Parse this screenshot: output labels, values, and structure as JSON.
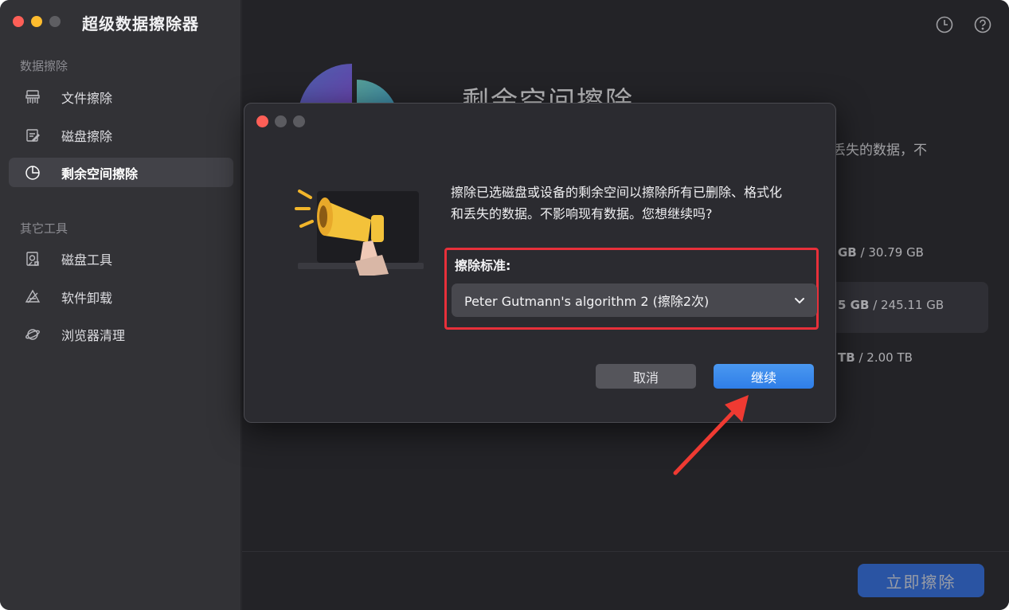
{
  "app": {
    "title": "超级数据擦除器"
  },
  "sidebar": {
    "section1": "数据擦除",
    "section2": "其它工具",
    "items": [
      {
        "label": "文件擦除",
        "icon": "shredder-icon"
      },
      {
        "label": "磁盘擦除",
        "icon": "disk-erase-icon"
      },
      {
        "label": "剩余空间擦除",
        "icon": "pie-chart-icon",
        "active": true
      },
      {
        "label": "磁盘工具",
        "icon": "disk-tools-icon"
      },
      {
        "label": "软件卸载",
        "icon": "uninstall-icon"
      },
      {
        "label": "浏览器清理",
        "icon": "browser-icon"
      }
    ]
  },
  "header": {
    "history_icon": "clock-icon",
    "help_icon": "help-icon"
  },
  "main": {
    "title": "剩余空间擦除",
    "desc_fragment": "司丢失的数据，不",
    "drives": [
      {
        "value": "GB",
        "total": "/ 30.79 GB"
      },
      {
        "value": "5 GB",
        "total": "/ 245.11 GB"
      },
      {
        "value": "TB",
        "total": "/ 2.00 TB"
      }
    ],
    "erase_button": "立即擦除"
  },
  "dialog": {
    "message": "擦除已选磁盘或设备的剩余空间以擦除所有已删除、格式化和丢失的数据。不影响现有数据。您想继续吗?",
    "standard_label": "擦除标准:",
    "standard_value": "Peter Gutmann's algorithm 2 (擦除2次)",
    "cancel_label": "取消",
    "continue_label": "继续"
  },
  "colors": {
    "accent": "#3478f6",
    "highlight": "#e8303a",
    "arrow": "#ef3a32"
  }
}
